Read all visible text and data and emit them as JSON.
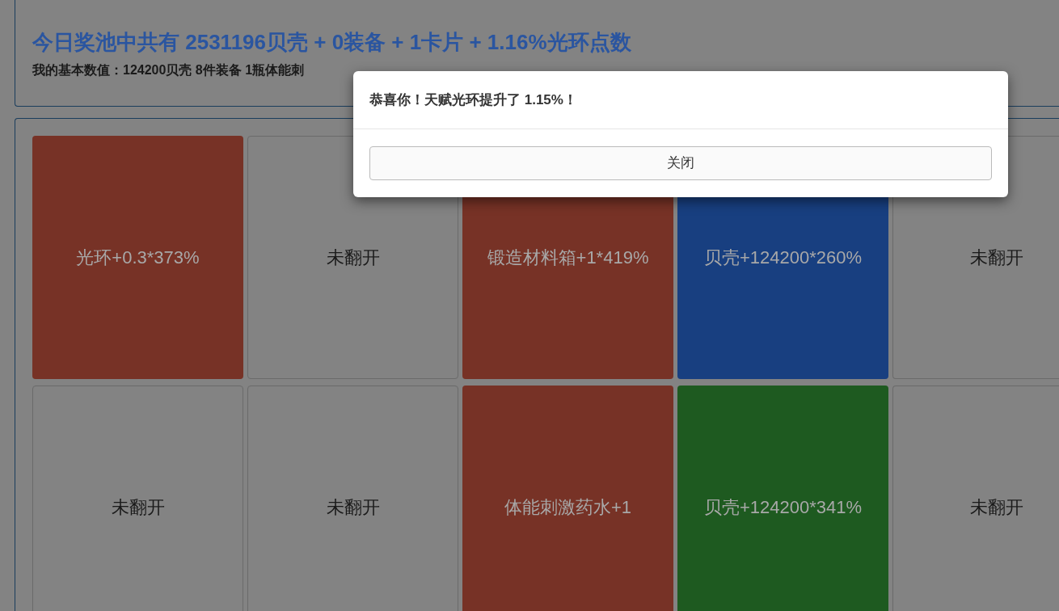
{
  "pool": {
    "title": "今日奖池中共有 2531196贝壳 + 0装备 + 1卡片 + 1.16%光环点数",
    "stats": "我的基本数值：124200贝壳 8件装备 1瓶体能刺"
  },
  "cards": [
    {
      "kind": "revealed",
      "label": "光环+0.3*373%",
      "color": "#773226"
    },
    {
      "kind": "hidden",
      "label": "未翻开"
    },
    {
      "kind": "revealed",
      "label": "锻造材料箱+1*419%",
      "color": "#773226"
    },
    {
      "kind": "revealed",
      "label": "贝壳+124200*260%",
      "color": "#183f80"
    },
    {
      "kind": "hidden",
      "label": "未翻开"
    },
    {
      "kind": "hidden",
      "label": "未翻开"
    },
    {
      "kind": "hidden",
      "label": "未翻开"
    },
    {
      "kind": "revealed",
      "label": "体能刺激药水+1",
      "color": "#773226"
    },
    {
      "kind": "revealed",
      "label": "贝壳+124200*341%",
      "color": "#1e5a20"
    },
    {
      "kind": "hidden",
      "label": "未翻开"
    }
  ],
  "dialog": {
    "message": "恭喜你！天赋光环提升了 1.15%！",
    "button": "关闭"
  }
}
